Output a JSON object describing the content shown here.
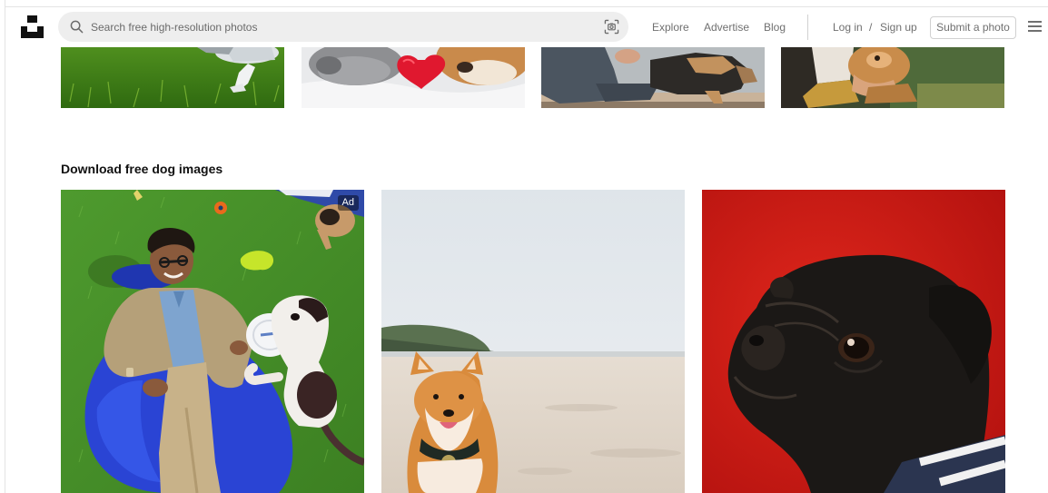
{
  "header": {
    "search_placeholder": "Search free high-resolution photos",
    "nav": {
      "explore": "Explore",
      "advertise": "Advertise",
      "blog": "Blog",
      "login": "Log in",
      "separator": "/",
      "signup": "Sign up",
      "submit": "Submit a photo"
    },
    "icons": [
      "unsplash-logo",
      "search-icon",
      "visual-search-icon",
      "hamburger-menu-icon"
    ]
  },
  "top_strip": {
    "photos": [
      {
        "subject": "dog-on-grass"
      },
      {
        "subject": "cat-and-dog-with-heart"
      },
      {
        "subject": "person-and-dog-sitting"
      },
      {
        "subject": "person-hugging-dog"
      }
    ]
  },
  "section": {
    "title": "Download free dog images",
    "photos": [
      {
        "subject": "man-on-beanbag-with-dog-and-frisbee",
        "badge": "Ad"
      },
      {
        "subject": "shiba-inu-on-beach"
      },
      {
        "subject": "black-pug-red-background"
      }
    ]
  },
  "colors": {
    "search_bg": "#eeeeee",
    "nav_text": "#707070",
    "heading_text": "#111111",
    "border": "#d1d1d1"
  }
}
